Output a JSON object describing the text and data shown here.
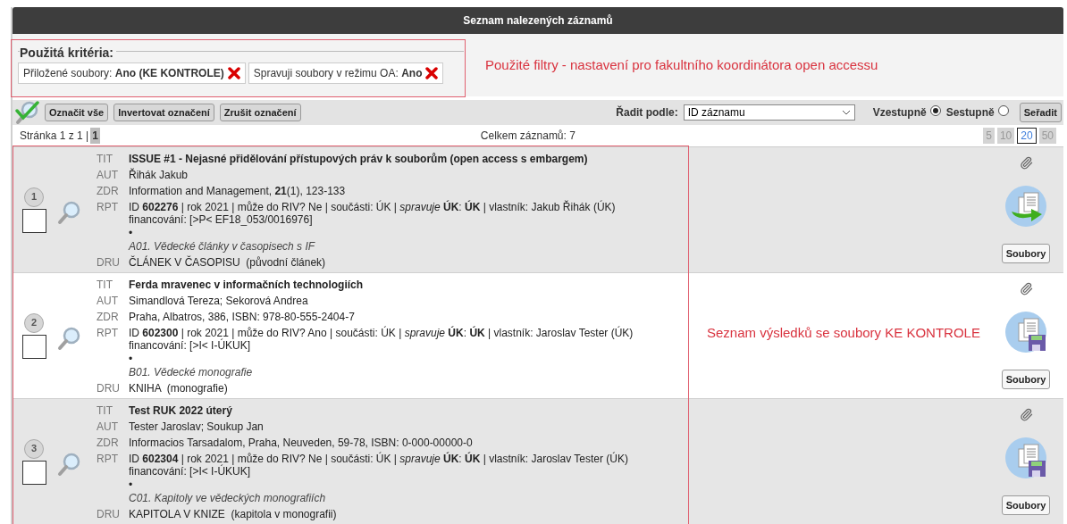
{
  "header": {
    "title": "Seznam nalezených záznamů"
  },
  "criteria": {
    "legend": "Použitá kritéria:",
    "items": [
      {
        "label": "Přiložené soubory:",
        "value": "Ano (KE KONTROLE)"
      },
      {
        "label": "Spravuji soubory v režimu OA:",
        "value": "Ano"
      }
    ]
  },
  "annotations": [
    {
      "kind": "filters",
      "text": "Použité filtry - nastavení pro fakultního koordinátora open accessu"
    },
    {
      "kind": "records",
      "text": "Seznam výsledků se soubory KE KONTROLE"
    }
  ],
  "toolbar": {
    "buttons": [
      "Označit vše",
      "Invertovat označení",
      "Zrušit označení"
    ],
    "sort_label": "Řadit podle:",
    "sort_value": "ID záznamu",
    "order": [
      {
        "label": "Vzestupně",
        "selected": true
      },
      {
        "label": "Sestupně",
        "selected": false
      }
    ],
    "sort_button": "Seřadit"
  },
  "pagination": {
    "page_info": "Stránka 1 z 1 |",
    "pages": [
      {
        "label": "1",
        "selected": true
      }
    ],
    "total": "Celkem záznamů: 7",
    "page_sizes": [
      {
        "label": "5",
        "selected": false
      },
      {
        "label": "10",
        "selected": false
      },
      {
        "label": "20",
        "selected": true
      },
      {
        "label": "50",
        "selected": false
      }
    ]
  },
  "records": [
    {
      "number": "1",
      "checked": false,
      "action": {
        "kind": "send"
      },
      "files_button": "Soubory",
      "fields": [
        {
          "kind": "title",
          "code": "TIT",
          "text": "ISSUE #1 - Nejasné přidělování přístupových práv k souborům (open access s embargem)"
        },
        {
          "kind": "plain",
          "code": "AUT",
          "text": "Řihák Jakub"
        },
        {
          "kind": "plain",
          "code": "ZDR",
          "text": "Information and Management, **21**(1), 123-133"
        },
        {
          "kind": "report",
          "code": "RPT",
          "text": "ID **602276** | rok 2021 | může do RIV? Ne | součásti: ÚK | *spravuje* **ÚK**: **ÚK** | vlastník: Jakub Řihák (ÚK)",
          "funding": "financování: [>P< EF18_053/0016976]",
          "bullet": "•",
          "category": "A01. Vědecké články v časopisech s IF"
        },
        {
          "kind": "plain",
          "code": "DRU",
          "text": "ČLÁNEK V ČASOPISU  (původní článek)"
        }
      ]
    },
    {
      "number": "2",
      "checked": false,
      "action": {
        "kind": "save"
      },
      "files_button": "Soubory",
      "fields": [
        {
          "kind": "title",
          "code": "TIT",
          "text": "Ferda mravenec v informačních technologiích"
        },
        {
          "kind": "plain",
          "code": "AUT",
          "text": "Simandlová Tereza; Sekorová Andrea"
        },
        {
          "kind": "plain",
          "code": "ZDR",
          "text": "Praha, Albatros, 386, ISBN: 978-80-555-2404-7"
        },
        {
          "kind": "report",
          "code": "RPT",
          "text": "ID **602300** | rok 2021 | může do RIV? Ano | součásti: ÚK | *spravuje* **ÚK**: **ÚK** | vlastník: Jaroslav Tester (ÚK)",
          "funding": "financování: [>I< I-ÚKUK]",
          "bullet": "•",
          "category": "B01. Vědecké monografie"
        },
        {
          "kind": "plain",
          "code": "DRU",
          "text": "KNIHA  (monografie)"
        }
      ]
    },
    {
      "number": "3",
      "checked": false,
      "action": {
        "kind": "save"
      },
      "files_button": "Soubory",
      "fields": [
        {
          "kind": "title",
          "code": "TIT",
          "text": "Test RUK 2022 úterý"
        },
        {
          "kind": "plain",
          "code": "AUT",
          "text": "Tester Jaroslav; Soukup Jan"
        },
        {
          "kind": "plain",
          "code": "ZDR",
          "text": "Informacios Tarsadalom, Praha, Neuveden, 59-78, ISBN: 0-000-00000-0"
        },
        {
          "kind": "report",
          "code": "RPT",
          "text": "ID **602304** | rok 2021 | může do RIV? Ne | součásti: ÚK | *spravuje* **ÚK**: **ÚK** | vlastník: Jaroslav Tester (ÚK)",
          "funding": "financování: [>I< I-ÚKUK]",
          "bullet": "•",
          "category": "C01. Kapitoly ve vědeckých monografiích"
        },
        {
          "kind": "plain",
          "code": "DRU",
          "text": "KAPITOLA V KNIZE  (kapitola v monografii)"
        }
      ]
    }
  ]
}
